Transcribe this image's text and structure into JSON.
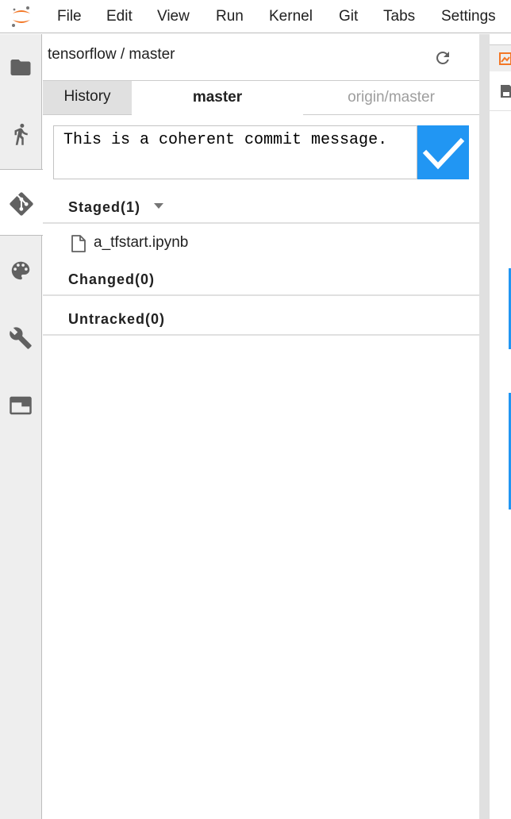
{
  "menubar": {
    "items": [
      "File",
      "Edit",
      "View",
      "Run",
      "Kernel",
      "Git",
      "Tabs",
      "Settings"
    ]
  },
  "sidebar": {
    "tabs": [
      {
        "icon": "folder-icon",
        "active": false
      },
      {
        "icon": "running-icon",
        "active": false
      },
      {
        "icon": "git-icon",
        "active": true
      },
      {
        "icon": "palette-icon",
        "active": false
      },
      {
        "icon": "wrench-icon",
        "active": false
      },
      {
        "icon": "tab-window-icon",
        "active": false
      }
    ]
  },
  "git_panel": {
    "repo_path": "tensorflow / master",
    "tabs": {
      "history": "History",
      "current_branch": "master",
      "remote_branch": "origin/master"
    },
    "commit": {
      "message": "This is a coherent commit message."
    },
    "sections": {
      "staged": {
        "label": "Staged(1)",
        "files": [
          "a_tfstart.ipynb"
        ]
      },
      "changed": {
        "label": "Changed(0)"
      },
      "untracked": {
        "label": "Untracked(0)"
      }
    }
  },
  "colors": {
    "accent": "#2196f3",
    "logo_orange": "#f37726",
    "sidebar_bg": "#eeeeee"
  }
}
